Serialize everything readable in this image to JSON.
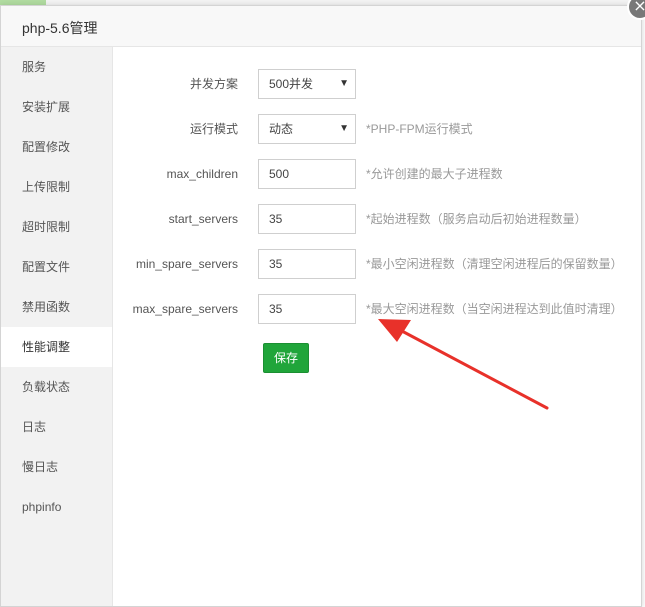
{
  "window": {
    "title": "php-5.6管理",
    "close_label": "×"
  },
  "sidebar": {
    "items": [
      {
        "label": "服务"
      },
      {
        "label": "安装扩展"
      },
      {
        "label": "配置修改"
      },
      {
        "label": "上传限制"
      },
      {
        "label": "超时限制"
      },
      {
        "label": "配置文件"
      },
      {
        "label": "禁用函数"
      },
      {
        "label": "性能调整",
        "active": true
      },
      {
        "label": "负载状态"
      },
      {
        "label": "日志"
      },
      {
        "label": "慢日志"
      },
      {
        "label": "phpinfo"
      }
    ]
  },
  "form": {
    "concurrency": {
      "label": "并发方案",
      "value": "500并发"
    },
    "run_mode": {
      "label": "运行模式",
      "value": "动态",
      "hint": "*PHP-FPM运行模式"
    },
    "max_children": {
      "label": "max_children",
      "value": "500",
      "hint": "*允许创建的最大子进程数"
    },
    "start_servers": {
      "label": "start_servers",
      "value": "35",
      "hint": "*起始进程数（服务启动后初始进程数量）"
    },
    "min_spare_servers": {
      "label": "min_spare_servers",
      "value": "35",
      "hint": "*最小空闲进程数（清理空闲进程后的保留数量）"
    },
    "max_spare_servers": {
      "label": "max_spare_servers",
      "value": "35",
      "hint": "*最大空闲进程数（当空闲进程达到此值时清理）"
    },
    "save_label": "保存"
  },
  "colors": {
    "accent": "#20a53a",
    "annotation_arrow": "#e8312a"
  }
}
